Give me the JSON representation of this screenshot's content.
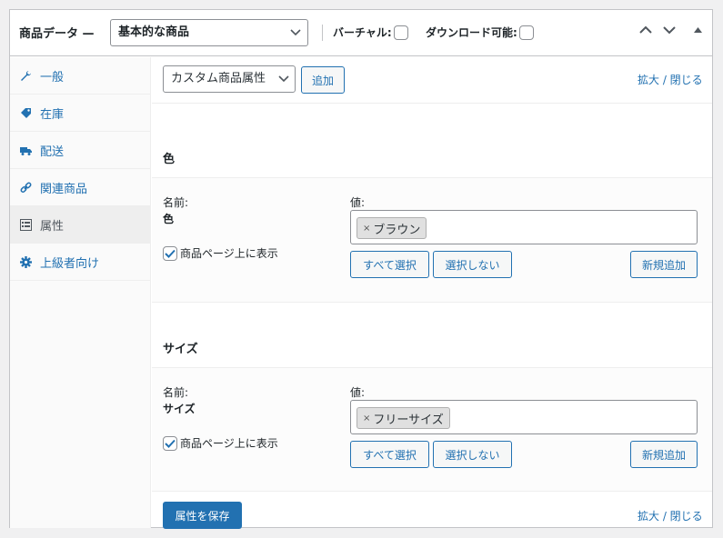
{
  "header": {
    "title": "商品データ —",
    "product_type": "基本的な商品",
    "virtual_label": "バーチャル:",
    "downloadable_label": "ダウンロード可能:"
  },
  "sidebar": {
    "items": [
      {
        "label": "一般",
        "icon": "wrench-icon"
      },
      {
        "label": "在庫",
        "icon": "tag-icon"
      },
      {
        "label": "配送",
        "icon": "truck-icon"
      },
      {
        "label": "関連商品",
        "icon": "link-icon"
      },
      {
        "label": "属性",
        "icon": "list-view-icon"
      },
      {
        "label": "上級者向け",
        "icon": "gear-icon"
      }
    ]
  },
  "toolbar": {
    "attribute_select": "カスタム商品属性",
    "add_label": "追加",
    "expand_collapse": "拡大 / 閉じる"
  },
  "attributes": [
    {
      "title": "色",
      "name_label": "名前:",
      "name_value": "色",
      "visible_label": "商品ページ上に表示",
      "values_label": "値:",
      "value_tag": "ブラウン",
      "select_all": "すべて選択",
      "select_none": "選択しない",
      "add_new": "新規追加"
    },
    {
      "title": "サイズ",
      "name_label": "名前:",
      "name_value": "サイズ",
      "visible_label": "商品ページ上に表示",
      "values_label": "値:",
      "value_tag": "フリーサイズ",
      "select_all": "すべて選択",
      "select_none": "選択しない",
      "add_new": "新規追加"
    }
  ],
  "footer": {
    "save_label": "属性を保存",
    "expand_collapse": "拡大 / 閉じる"
  },
  "colors": {
    "accent": "#2271b1",
    "border": "#c3c4c7"
  }
}
